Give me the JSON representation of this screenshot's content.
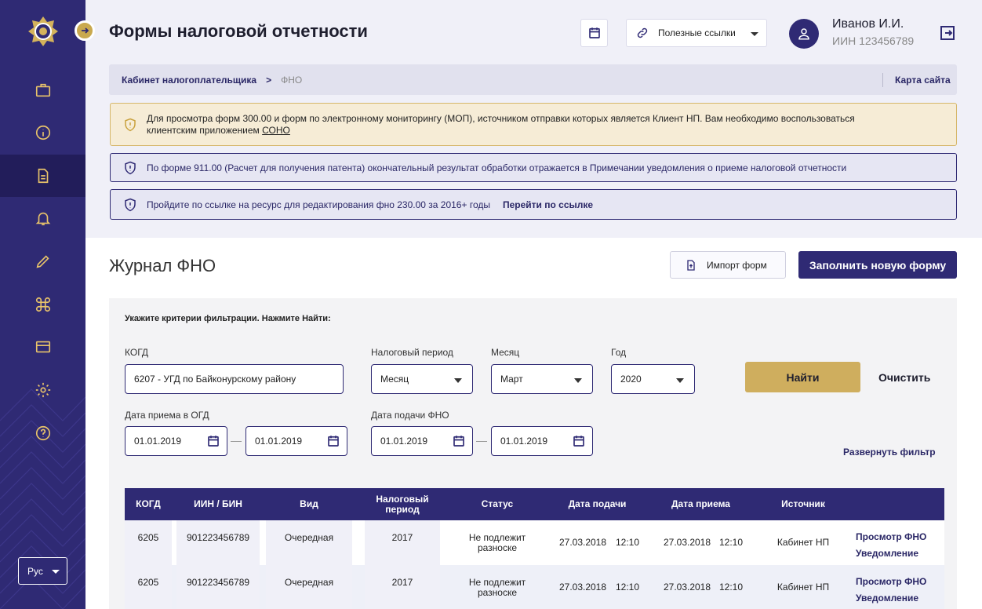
{
  "colors": {
    "primary": "#2f2a74",
    "accent": "#cfae5e",
    "warning_bg": "#f6ecd6"
  },
  "sidebar": {
    "logo": "emblem-logo",
    "items": [
      {
        "icon": "briefcase-icon"
      },
      {
        "icon": "info-icon"
      },
      {
        "icon": "document-icon",
        "active": true
      },
      {
        "icon": "bell-icon"
      },
      {
        "icon": "pencil-icon"
      },
      {
        "icon": "command-icon"
      },
      {
        "icon": "card-icon"
      },
      {
        "icon": "gear-icon"
      },
      {
        "icon": "help-icon"
      }
    ],
    "language": "Рус"
  },
  "header": {
    "title": "Формы налоговой отчетности",
    "links_label": "Полезные ссылки",
    "user_name": "Иванов И.И.",
    "user_iin": "ИИН 123456789"
  },
  "breadcrumb": {
    "items": [
      "Кабинет налогоплательщика",
      "ФНО"
    ],
    "separator": ">",
    "sitemap": "Карта сайта"
  },
  "alerts": {
    "warning_text": "Для просмотра форм 300.00 и форм по электронному мониторингу (МОП), источником отправки которых является Клиент НП. Вам необходимо воспользоваться клиентским приложением ",
    "warning_link": "СОНО",
    "info1": "По форме 911.00 (Расчет для получения патента) окончательный результат обработки отражается в Примечании уведомления о приеме налоговой отчетности",
    "info2": "Пройдите по ссылке на ресурс для редактирования фно 230.00 за 2016+ годы",
    "info2_link": "Перейти по ссылке"
  },
  "journal": {
    "title": "Журнал ФНО",
    "import_label": "Импорт форм",
    "new_label": "Заполнить новую форму"
  },
  "filter": {
    "hint": "Укажите  критерии фильтрации. Нажмите Найти:",
    "kogd_label": "КОГД",
    "kogd_value": "6207 - УГД по Байконурскому району",
    "period_label": "Налоговый период",
    "period_value": "Месяц",
    "month_label": "Месяц",
    "month_value": "Март",
    "year_label": "Год",
    "year_value": "2020",
    "receive_label": "Дата приема в ОГД",
    "receive_from": "01.01.2019",
    "receive_to": "01.01.2019",
    "submit_label": "Дата подачи ФНО",
    "submit_from": "01.01.2019",
    "submit_to": "01.01.2019",
    "find_label": "Найти",
    "clear_label": "Очистить",
    "expand_label": "Развернуть фильтр"
  },
  "table": {
    "headers": [
      "КОГД",
      "ИИН / БИН",
      "Вид",
      "Налоговый период",
      "Статус",
      "Дата подачи",
      "Дата приема",
      "Источник"
    ],
    "rows": [
      {
        "kogd": "6205",
        "iin": "901223456789",
        "kind": "Очередная",
        "period": "2017",
        "status": "Не подлежит разноске",
        "submit_date": "27.03.2018",
        "submit_time": "12:10",
        "receive_date": "27.03.2018",
        "receive_time": "12:10",
        "source": "Кабинет НП",
        "view": "Просмотр ФНО",
        "notice": "Уведомление"
      },
      {
        "kogd": "6205",
        "iin": "901223456789",
        "kind": "Очередная",
        "period": "2017",
        "status": "Не подлежит разноске",
        "submit_date": "27.03.2018",
        "submit_time": "12:10",
        "receive_date": "27.03.2018",
        "receive_time": "12:10",
        "source": "Кабинет НП",
        "view": "Просмотр ФНО",
        "notice": "Уведомление"
      }
    ]
  }
}
